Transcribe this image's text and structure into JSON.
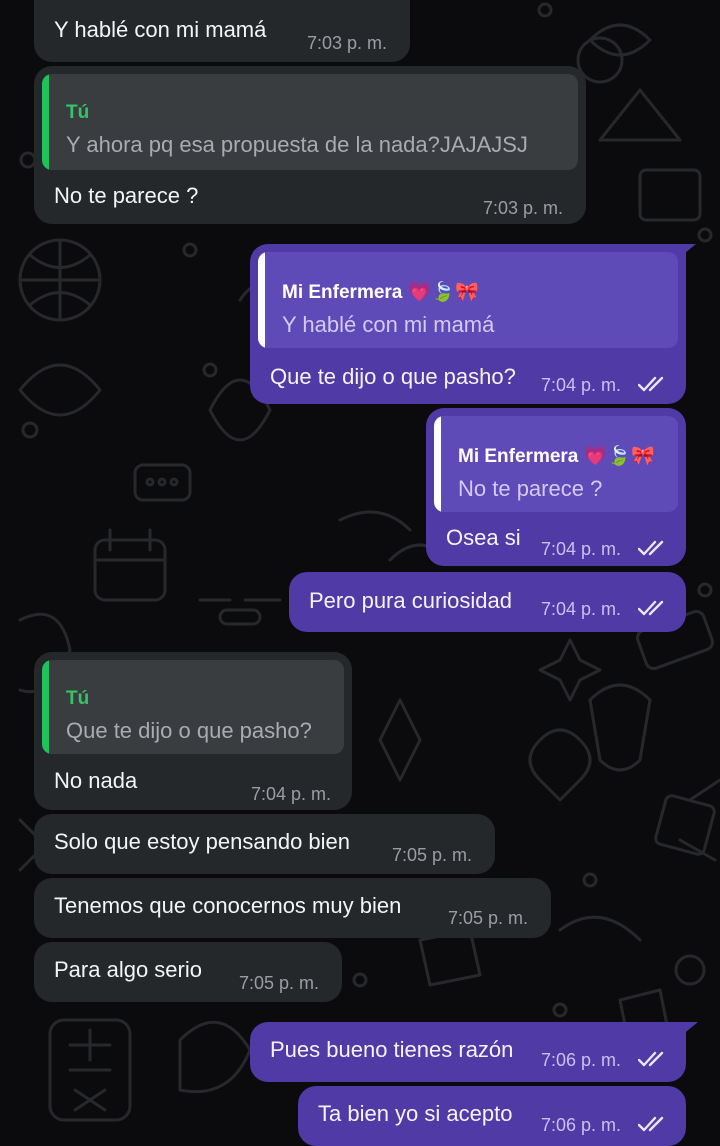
{
  "colors": {
    "background": "#0b0b0d",
    "incoming_bubble": "#25282b",
    "outgoing_bubble": "#4f3aa6",
    "quote_incoming_bar": "#20c25a",
    "quote_outgoing_bar": "#ffffff",
    "read_ticks": "#e9e6f7"
  },
  "messages": [
    {
      "direction": "incoming",
      "text": "Y hablé con mi mamá",
      "time": "7:03 p. m."
    },
    {
      "direction": "incoming",
      "quote_author": "Tú",
      "quote_text": "Y ahora pq esa propuesta de la nada?JAJAJSJ",
      "text": "No te parece ?",
      "time": "7:03 p. m."
    },
    {
      "direction": "outgoing",
      "quote_author": "Mi Enfermera 💗🍃🎀",
      "quote_text": "Y hablé con mi mamá",
      "text": "Que te dijo o que pasho?",
      "time": "7:04 p. m.",
      "status_icon": "double-check-icon"
    },
    {
      "direction": "outgoing",
      "quote_author": "Mi Enfermera 💗🍃🎀",
      "quote_text": "No te parece ?",
      "text": "Osea si",
      "time": "7:04 p. m.",
      "status_icon": "double-check-icon"
    },
    {
      "direction": "outgoing",
      "text": "Pero pura curiosidad",
      "time": "7:04 p. m.",
      "status_icon": "double-check-icon"
    },
    {
      "direction": "incoming",
      "quote_author": "Tú",
      "quote_text": "Que te dijo o que pasho?",
      "text": "No nada",
      "time": "7:04 p. m."
    },
    {
      "direction": "incoming",
      "text": "Solo que estoy pensando bien",
      "time": "7:05 p. m."
    },
    {
      "direction": "incoming",
      "text": "Tenemos que conocernos muy bien",
      "time": "7:05 p. m."
    },
    {
      "direction": "incoming",
      "text": "Para algo serio",
      "time": "7:05 p. m."
    },
    {
      "direction": "outgoing",
      "text": "Pues bueno tienes razón",
      "time": "7:06 p. m.",
      "status_icon": "double-check-icon"
    },
    {
      "direction": "outgoing",
      "text": "Ta bien yo si acepto",
      "time": "7:06 p. m.",
      "status_icon": "double-check-icon"
    }
  ]
}
